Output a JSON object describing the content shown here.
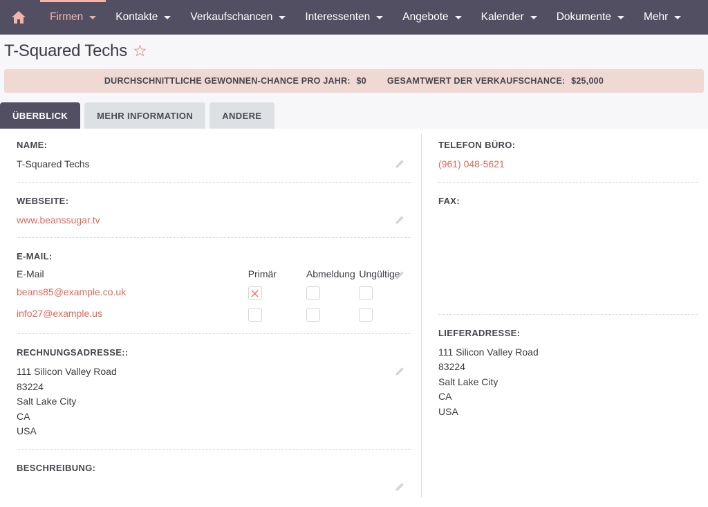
{
  "navbar": {
    "home_icon": "home-icon",
    "items": [
      {
        "label": "Firmen",
        "active": true
      },
      {
        "label": "Kontakte",
        "active": false
      },
      {
        "label": "Verkaufschancen",
        "active": false
      },
      {
        "label": "Interessenten",
        "active": false
      },
      {
        "label": "Angebote",
        "active": false
      },
      {
        "label": "Kalender",
        "active": false
      },
      {
        "label": "Dokumente",
        "active": false
      },
      {
        "label": "Mehr",
        "active": false
      }
    ],
    "background_color": "#534f62",
    "active_color": "#f3b5ab"
  },
  "header": {
    "title": "T-Squared Techs",
    "favorite_icon": "star-outline-icon"
  },
  "banner": {
    "background_color": "#f0d9d3",
    "stats": [
      {
        "label": "DURCHSCHNITTLICHE GEWONNEN-CHANCE PRO JAHR:",
        "value": "$0"
      },
      {
        "label": "GESAMTWERT DER VERKAUFSCHANCE:",
        "value": "$25,000"
      }
    ]
  },
  "tabs": [
    {
      "label": "ÜBERBLICK",
      "active": true
    },
    {
      "label": "MEHR INFORMATION",
      "active": false
    },
    {
      "label": "ANDERE",
      "active": false
    }
  ],
  "left_column": {
    "name": {
      "label": "NAME:",
      "value": "T-Squared Techs",
      "edit_icon": "pencil-icon"
    },
    "website": {
      "label": "WEBSEITE:",
      "value": "www.beanssugar.tv",
      "edit_icon": "pencil-icon"
    },
    "email": {
      "label": "E-MAIL:",
      "edit_icon": "pencil-icon",
      "columns": [
        "E-Mail",
        "Primär",
        "Abmeldung",
        "Ungültige"
      ],
      "rows": [
        {
          "address": "beans85@example.co.uk",
          "primary": true,
          "opt_out": false,
          "invalid": false
        },
        {
          "address": "info27@example.us",
          "primary": false,
          "opt_out": false,
          "invalid": false
        }
      ]
    },
    "billing_address": {
      "label": "RECHNUNGSADRESSE::",
      "edit_icon": "pencil-icon",
      "lines": [
        "111 Silicon Valley Road",
        "83224",
        "Salt Lake City",
        "CA",
        "USA"
      ]
    },
    "description": {
      "label": "BESCHREIBUNG:",
      "value": "",
      "edit_icon": "pencil-icon"
    }
  },
  "right_column": {
    "office_phone": {
      "label": "TELEFON BÜRO:",
      "value": "(961) 048-5621",
      "edit_icon": "pencil-icon"
    },
    "fax": {
      "label": "FAX:",
      "value": "",
      "edit_icon": "pencil-icon"
    },
    "shipping_address": {
      "label": "LIEFERADRESSE:",
      "edit_icon": "pencil-icon",
      "lines": [
        "111 Silicon Valley Road",
        "83224",
        "Salt Lake City",
        "CA",
        "USA"
      ]
    }
  },
  "colors": {
    "accent_link": "#d9695a",
    "nav_bg": "#534f62",
    "banner_bg": "#f0d9d3",
    "tab_inactive_bg": "#dde1e3"
  }
}
